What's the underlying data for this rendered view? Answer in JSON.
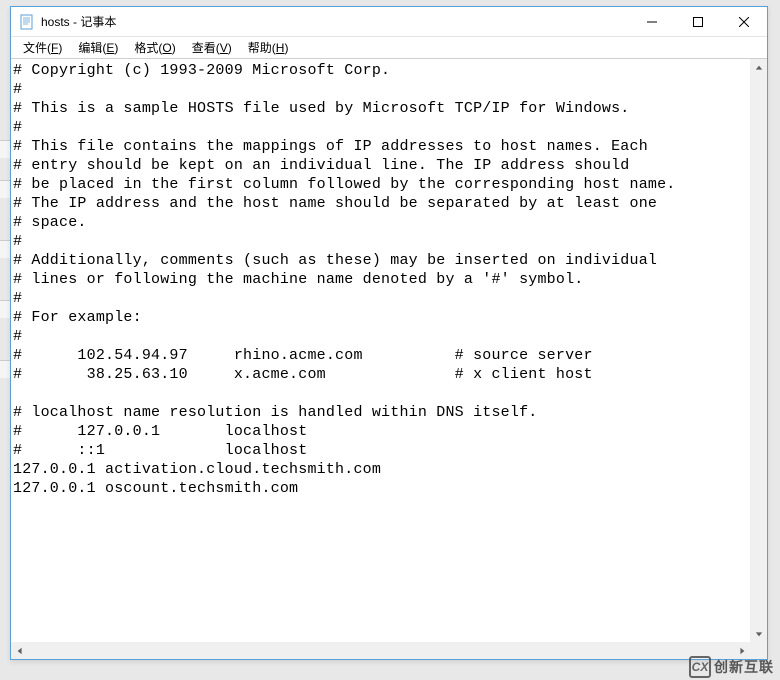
{
  "title": "hosts - 记事本",
  "menu": [
    {
      "label": "文件",
      "accel": "F"
    },
    {
      "label": "编辑",
      "accel": "E"
    },
    {
      "label": "格式",
      "accel": "O"
    },
    {
      "label": "查看",
      "accel": "V"
    },
    {
      "label": "帮助",
      "accel": "H"
    }
  ],
  "content": "# Copyright (c) 1993-2009 Microsoft Corp.\n#\n# This is a sample HOSTS file used by Microsoft TCP/IP for Windows.\n#\n# This file contains the mappings of IP addresses to host names. Each\n# entry should be kept on an individual line. The IP address should\n# be placed in the first column followed by the corresponding host name.\n# The IP address and the host name should be separated by at least one\n# space.\n#\n# Additionally, comments (such as these) may be inserted on individual\n# lines or following the machine name denoted by a '#' symbol.\n#\n# For example:\n#\n#      102.54.94.97     rhino.acme.com          # source server\n#       38.25.63.10     x.acme.com              # x client host\n\n# localhost name resolution is handled within DNS itself.\n#      127.0.0.1       localhost\n#      ::1             localhost\n127.0.0.1 activation.cloud.techsmith.com\n127.0.0.1 oscount.techsmith.com",
  "watermark": {
    "logo_text": "CX",
    "text": "创新互联"
  }
}
